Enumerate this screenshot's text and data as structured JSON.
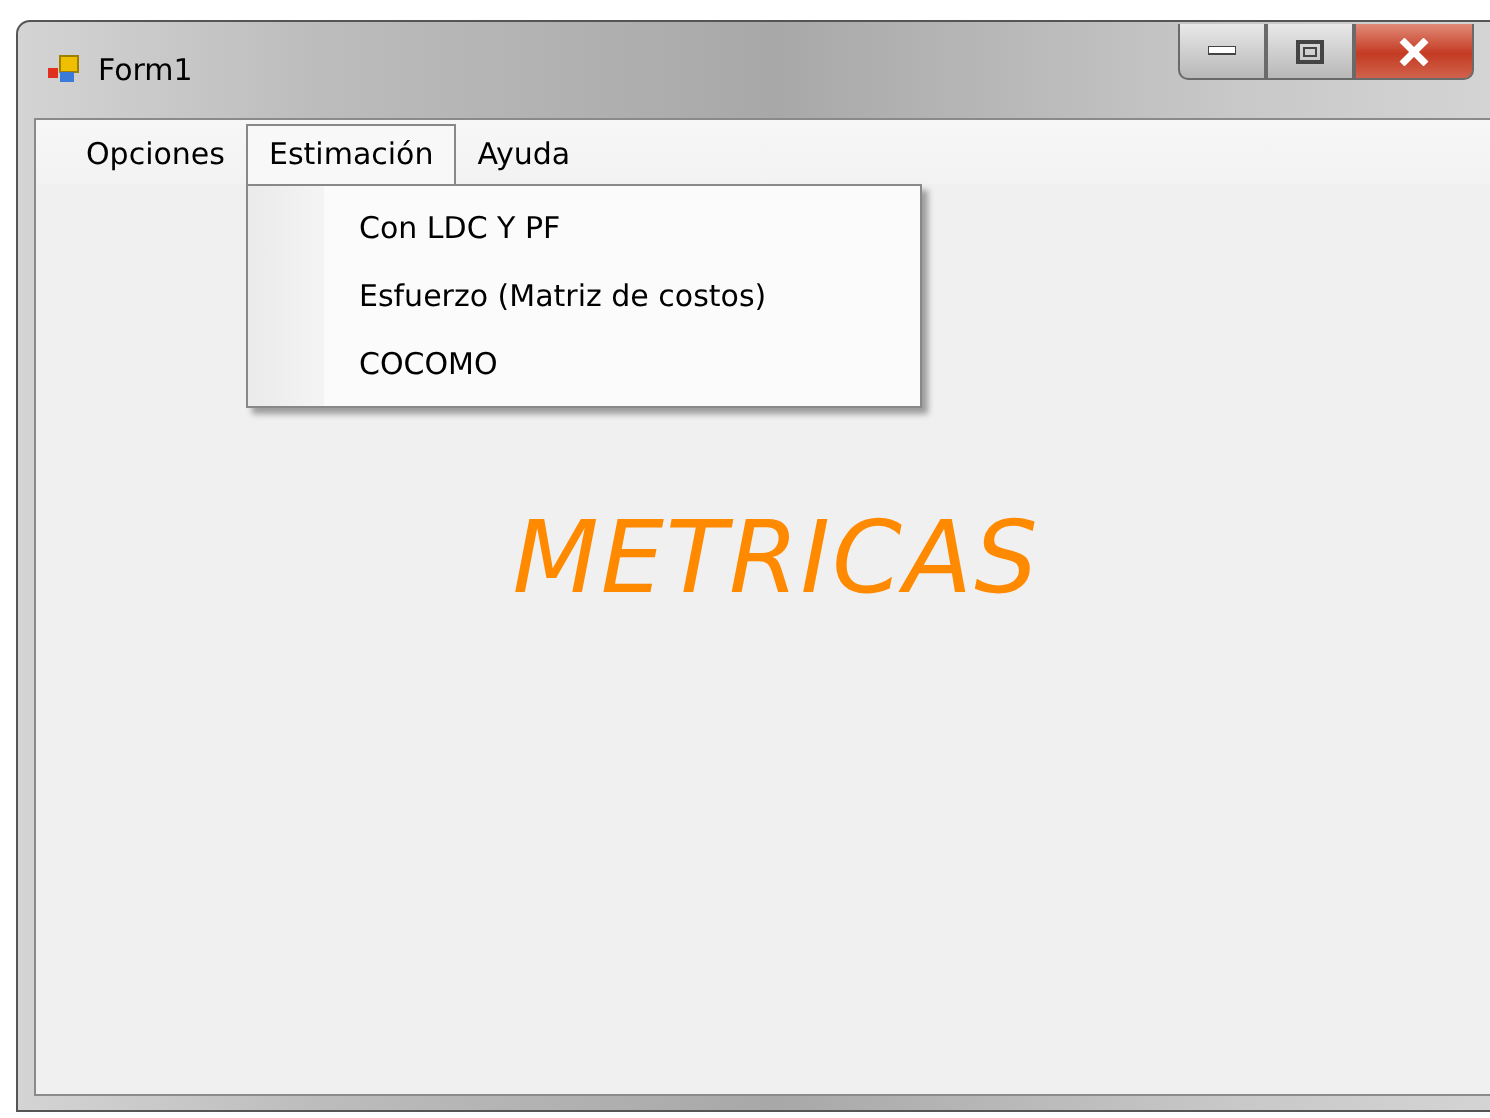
{
  "window": {
    "title": "Form1"
  },
  "menu": [
    {
      "label": "Opciones",
      "selected": false
    },
    {
      "label": "Estimación",
      "selected": true
    },
    {
      "label": "Ayuda",
      "selected": false
    }
  ],
  "dropdown": [
    "Con LDC Y PF",
    "Esfuerzo (Matriz de costos)",
    "COCOMO"
  ],
  "heading": "METRICAS"
}
